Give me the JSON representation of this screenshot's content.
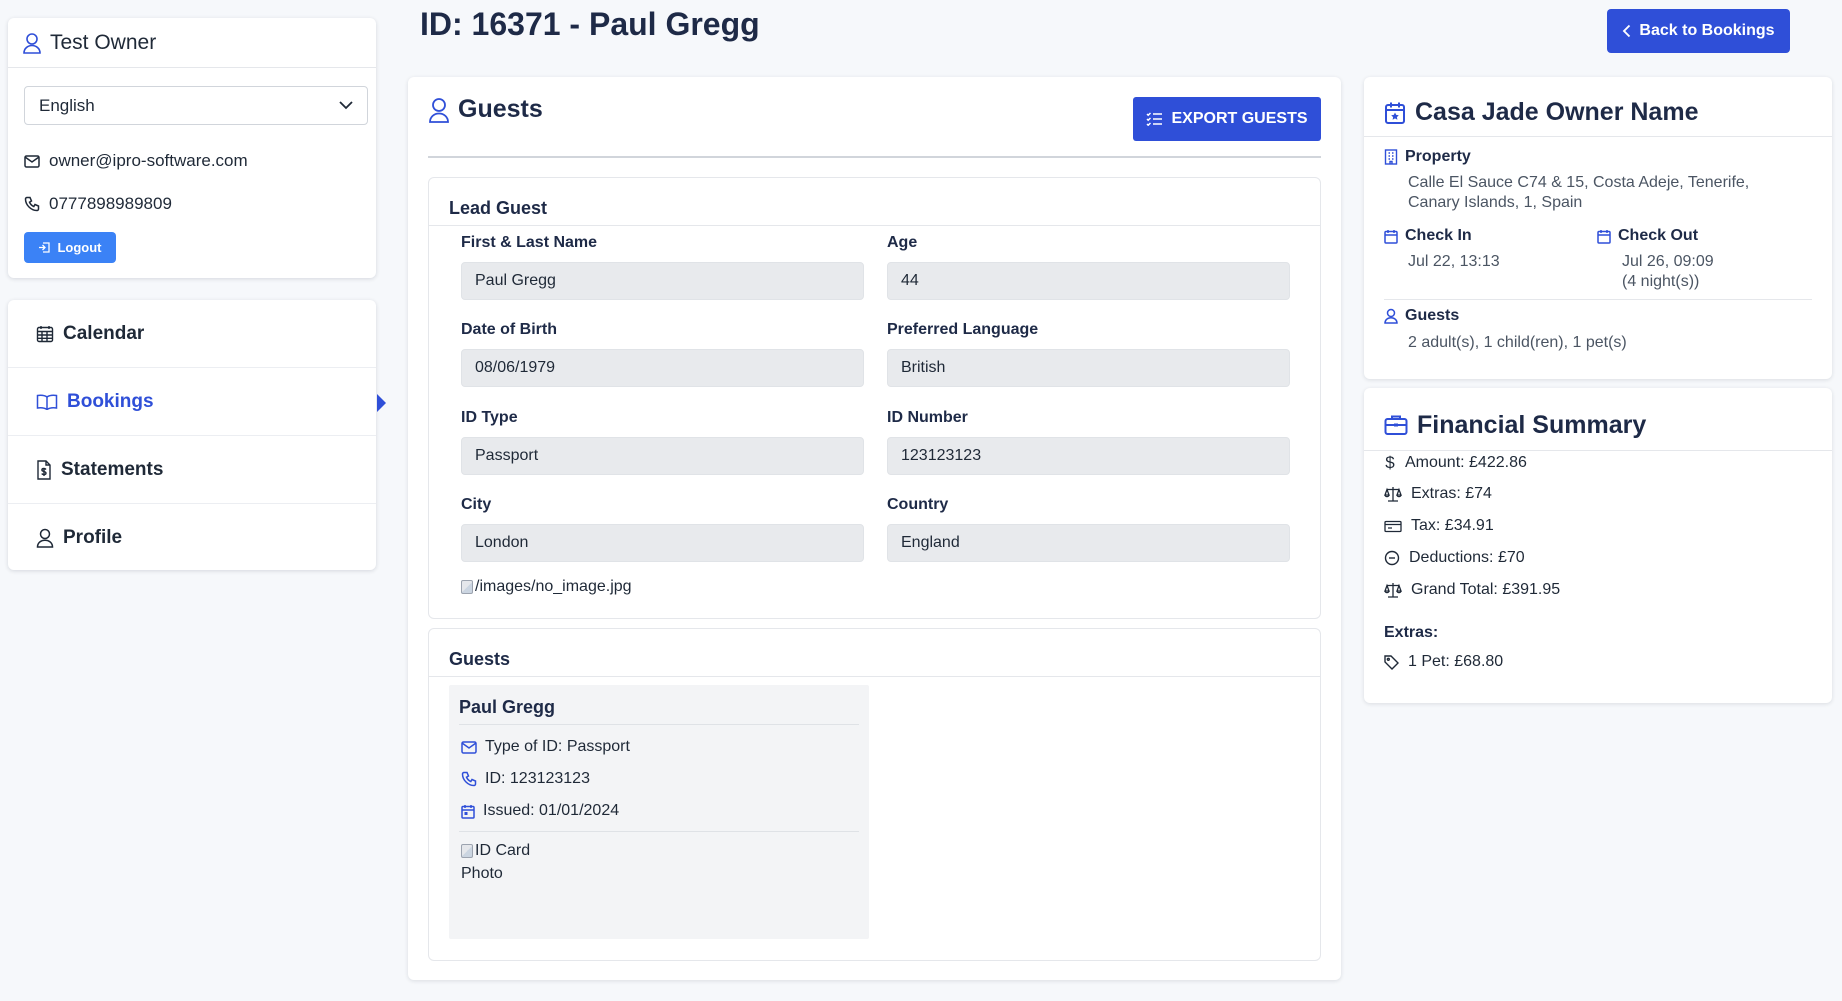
{
  "user": {
    "name": "Test Owner",
    "language": "English",
    "email": "owner@ipro-software.com",
    "phone": "0777898989809",
    "logout_label": "Logout"
  },
  "nav": {
    "items": [
      {
        "label": "Calendar",
        "icon": "calendar-grid-icon"
      },
      {
        "label": "Bookings",
        "icon": "book-open-icon"
      },
      {
        "label": "Statements",
        "icon": "receipt-icon"
      },
      {
        "label": "Profile",
        "icon": "user-icon"
      }
    ],
    "active": "Bookings"
  },
  "page": {
    "title": "ID: 16371 - Paul Gregg",
    "back_label": "Back to Bookings"
  },
  "guests_panel": {
    "title": "Guests",
    "export_label": "EXPORT GUESTS",
    "lead_guest": {
      "title": "Lead Guest",
      "fields": [
        {
          "label": "First & Last Name",
          "value": "Paul Gregg"
        },
        {
          "label": "Age",
          "value": "44"
        },
        {
          "label": "Date of Birth",
          "value": "08/06/1979"
        },
        {
          "label": "Preferred Language",
          "value": "British"
        },
        {
          "label": "ID Type",
          "value": "Passport"
        },
        {
          "label": "ID Number",
          "value": "123123123"
        },
        {
          "label": "City",
          "value": "London"
        },
        {
          "label": "Country",
          "value": "England"
        }
      ],
      "image_alt": "/images/no_image.jpg"
    },
    "guests": {
      "title": "Guests",
      "items": [
        {
          "name": "Paul Gregg",
          "id_type": "Type of ID: Passport",
          "id_number": "ID: 123123123",
          "issued": "Issued: 01/01/2024",
          "photo_alt_1": "ID Card",
          "photo_alt_2": "Photo"
        }
      ]
    }
  },
  "property_card": {
    "title": "Casa Jade Owner Name",
    "property_label": "Property",
    "address_line1": "Calle El Sauce C74 & 15, Costa Adeje, Tenerife,",
    "address_line2": "Canary Islands, 1, Spain",
    "check_in_label": "Check In",
    "check_in_value": "Jul 22, 13:13",
    "check_out_label": "Check Out",
    "check_out_value": "Jul 26, 09:09",
    "nights": "(4 night(s))",
    "guests_label": "Guests",
    "guests_value": "2 adult(s), 1 child(ren), 1 pet(s)"
  },
  "financial": {
    "title": "Financial Summary",
    "rows": [
      {
        "text": "Amount: £422.86",
        "icon": "dollar-icon"
      },
      {
        "text": "Extras: £74",
        "icon": "scale-icon"
      },
      {
        "text": "Tax: £34.91",
        "icon": "money-bill-icon"
      },
      {
        "text": "Deductions: £70",
        "icon": "minus-circle-icon"
      },
      {
        "text": "Grand Total: £391.95",
        "icon": "scale-icon"
      }
    ],
    "extras_title": "Extras:",
    "extras": [
      {
        "text": "1 Pet: £68.80",
        "icon": "tag-icon"
      }
    ]
  },
  "colors": {
    "accent": "#2f4fd8",
    "logout": "#3b82f6",
    "background": "#f6f8fb",
    "field_bg": "#e8eaed"
  }
}
